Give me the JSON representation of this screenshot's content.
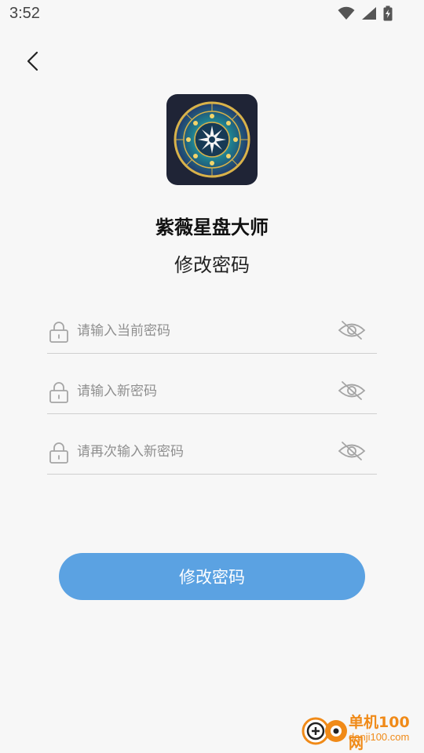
{
  "status_bar": {
    "time": "3:52",
    "icons": [
      "wifi-icon",
      "signal-icon",
      "battery-charging-icon"
    ]
  },
  "header": {
    "back_icon": "chevron-left-icon"
  },
  "app": {
    "name": "紫薇星盘大师",
    "icon": "zodiac-wheel-icon"
  },
  "page_title": "修改密码",
  "form": {
    "fields": [
      {
        "placeholder": "请输入当前密码",
        "value": "",
        "lock_icon": "lock-icon",
        "toggle_icon": "eye-off-icon"
      },
      {
        "placeholder": "请输入新密码",
        "value": "",
        "lock_icon": "lock-icon",
        "toggle_icon": "eye-off-icon"
      },
      {
        "placeholder": "请再次输入新密码",
        "value": "",
        "lock_icon": "lock-icon",
        "toggle_icon": "eye-off-icon"
      }
    ],
    "submit_label": "修改密码"
  },
  "watermark": {
    "name": "单机100网",
    "url": "danji100.com"
  },
  "colors": {
    "background": "#f7f7f7",
    "button": "#5ba2e2",
    "watermark": "#f08a18"
  }
}
